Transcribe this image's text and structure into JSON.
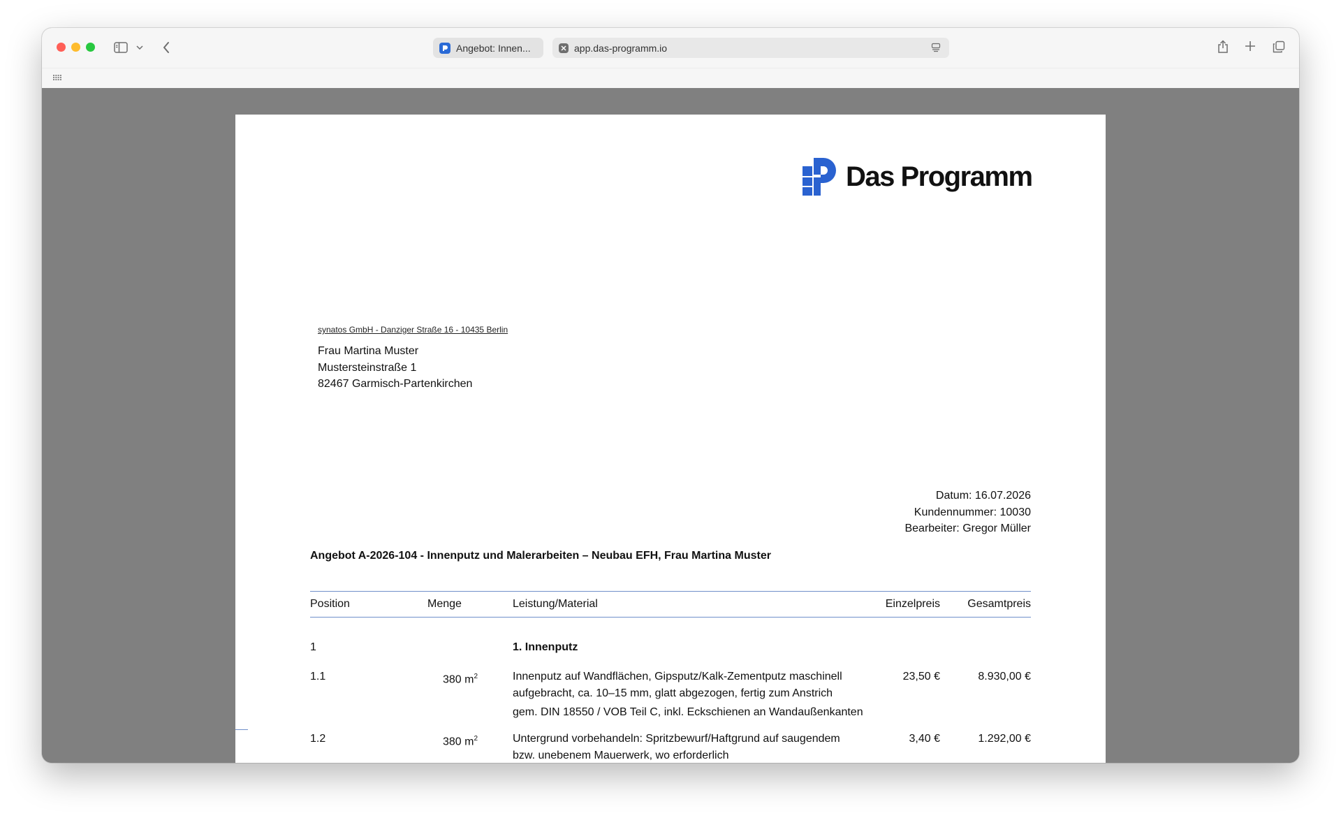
{
  "browser": {
    "tab_title": "Angebot: Innen...",
    "address": "app.das-programm.io"
  },
  "document": {
    "logo_text": "Das Programm",
    "sender_line": "synatos GmbH - Danziger Straße 16 - 10435 Berlin",
    "recipient": {
      "name": "Frau Martina Muster",
      "street": "Mustersteinstraße 1",
      "city": "82467 Garmisch-Partenkirchen"
    },
    "meta": {
      "date": "Datum: 16.07.2026",
      "customer_no": "Kundennummer: 10030",
      "editor": "Bearbeiter: Gregor Müller"
    },
    "subject": "Angebot A-2026-104 - Innenputz und Malerarbeiten – Neubau EFH, Frau Martina Muster",
    "table": {
      "headers": {
        "position": "Position",
        "quantity": "Menge",
        "service": "Leistung/Material",
        "unit_price": "Einzelpreis",
        "total_price": "Gesamtpreis"
      },
      "section": {
        "pos": "1",
        "title": "1. Innenputz"
      },
      "rows": [
        {
          "pos": "1.1",
          "qty": "380 m",
          "qty_sup": "2",
          "desc_1": "Innenputz auf Wandflächen, Gipsputz/Kalk-Zementputz maschinell",
          "desc_2": "aufgebracht, ca. 10–15 mm, glatt abgezogen, fertig zum Anstrich",
          "desc_3": "gem. DIN 18550 / VOB Teil C, inkl. Eckschienen an Wandaußenkanten",
          "unit": "23,50 €",
          "total": "8.930,00 €"
        },
        {
          "pos": "1.2",
          "qty": "380 m",
          "qty_sup": "2",
          "desc_1": "Untergrund vorbehandeln: Spritzbewurf/Haftgrund auf saugendem",
          "desc_2": "bzw. unebenem Mauerwerk, wo erforderlich",
          "unit": "3,40 €",
          "total": "1.292,00 €"
        }
      ]
    }
  }
}
